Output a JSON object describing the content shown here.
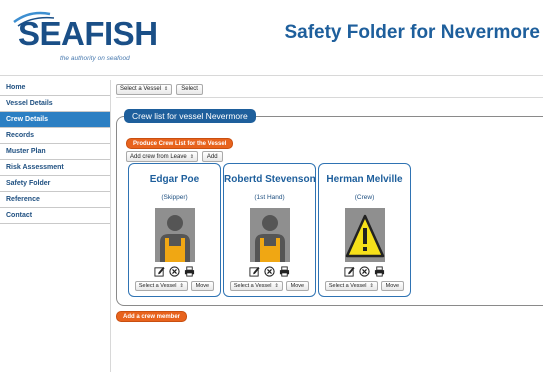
{
  "logo": {
    "word": "SEAFISH",
    "tagline": "the authority on seafood"
  },
  "page_title": "Safety Folder for Nevermore",
  "sidebar": {
    "items": [
      {
        "label": "Home",
        "active": false
      },
      {
        "label": "Vessel Details",
        "active": false
      },
      {
        "label": "Crew Details",
        "active": true
      },
      {
        "label": "Records",
        "active": false
      },
      {
        "label": "Muster Plan",
        "active": false
      },
      {
        "label": "Risk Assessment",
        "active": false
      },
      {
        "label": "Safety Folder",
        "active": false
      },
      {
        "label": "Reference",
        "active": false
      },
      {
        "label": "Contact",
        "active": false
      }
    ]
  },
  "topbar": {
    "vessel_select": "Select a Vessel",
    "select_button": "Select"
  },
  "crew_panel": {
    "legend": "Crew list for vessel Nevermore",
    "produce_button": "Produce Crew List for the Vessel",
    "leave_select": "Add crew from Leave",
    "add_button": "Add"
  },
  "crew": [
    {
      "name": "Edgar Poe",
      "role": "(Skipper)",
      "portrait": "person-silhouette",
      "vessel_select": "Select a Vessel",
      "move_button": "Move"
    },
    {
      "name": "Robertd Stevenson",
      "role": "(1st Hand)",
      "portrait": "person-silhouette",
      "vessel_select": "Select a Vessel",
      "move_button": "Move"
    },
    {
      "name": "Herman Melville",
      "role": "(Crew)",
      "portrait": "warning-sign",
      "vessel_select": "Select a Vessel",
      "move_button": "Move"
    }
  ],
  "add_crew_member_button": "Add a crew member",
  "colors": {
    "brand_blue": "#1e5f9c",
    "active_nav": "#2c7fc3",
    "orange": "#e8631d"
  }
}
